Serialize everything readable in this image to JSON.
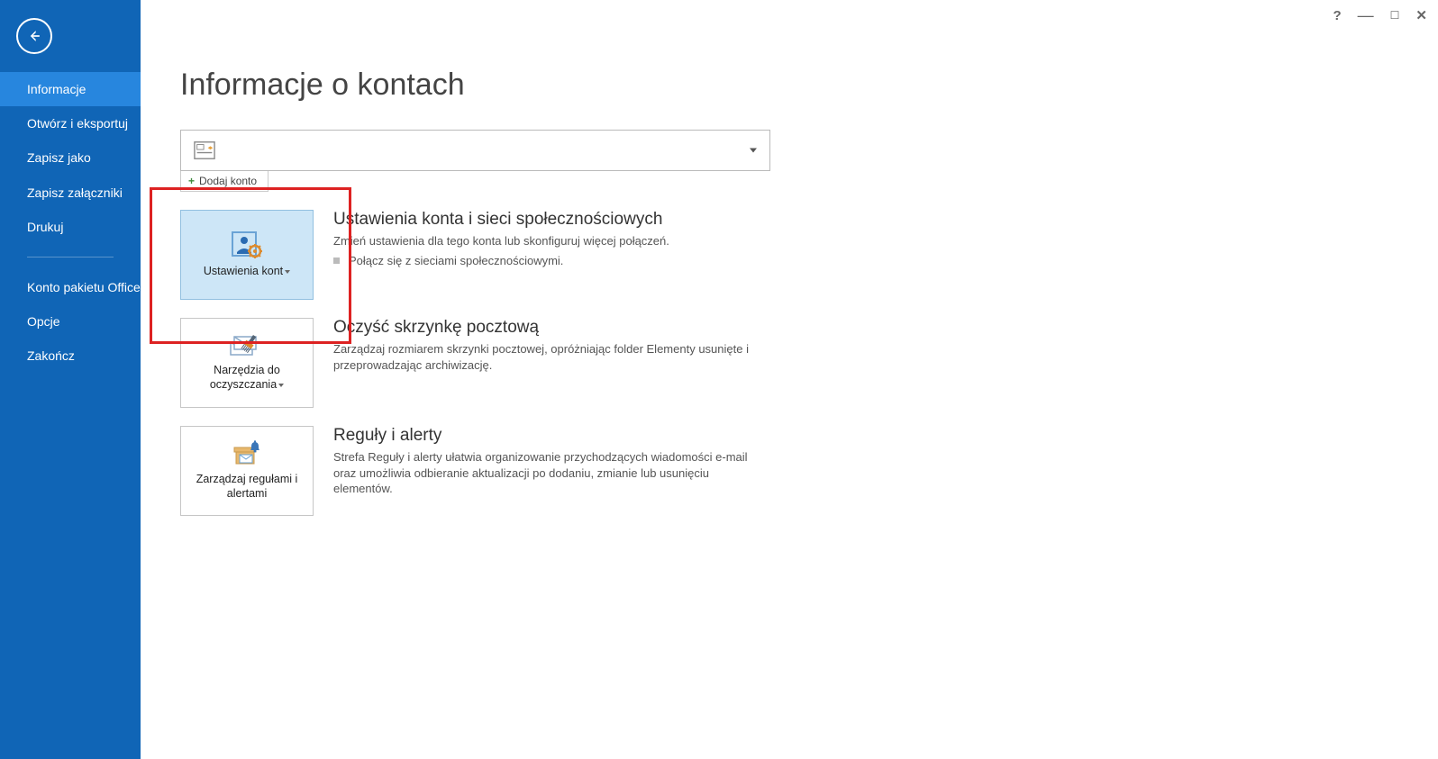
{
  "titlebar": {
    "help": "?"
  },
  "sidebar": {
    "items": [
      {
        "label": "Informacje",
        "active": true
      },
      {
        "label": "Otwórz i eksportuj"
      },
      {
        "label": "Zapisz jako"
      },
      {
        "label": "Zapisz załączniki"
      },
      {
        "label": "Drukuj"
      }
    ],
    "bottom": [
      {
        "label": "Konto pakietu Office"
      },
      {
        "label": "Opcje"
      },
      {
        "label": "Zakończ"
      }
    ]
  },
  "page": {
    "title": "Informacje o kontach",
    "add_account": "Dodaj konto"
  },
  "sections": [
    {
      "btn_label": "Ustawienia kont",
      "has_caret": true,
      "highlighted": true,
      "heading": "Ustawienia konta i sieci społecznościowych",
      "desc": "Zmień ustawienia dla tego konta lub skonfiguruj więcej połączeń.",
      "bullet": "Połącz się z sieciami społecznościowymi."
    },
    {
      "btn_label": "Narzędzia do oczyszczania",
      "has_caret": true,
      "heading": "Oczyść skrzynkę pocztową",
      "desc": "Zarządzaj rozmiarem skrzynki pocztowej, opróżniając folder Elementy usunięte i przeprowadzając archiwizację."
    },
    {
      "btn_label": "Zarządzaj regułami i alertami",
      "has_caret": false,
      "heading": "Reguły i alerty",
      "desc": "Strefa Reguły i alerty ułatwia organizowanie przychodzących wiadomości e-mail oraz umożliwia odbieranie aktualizacji po dodaniu, zmianie lub usunięciu elementów."
    }
  ]
}
